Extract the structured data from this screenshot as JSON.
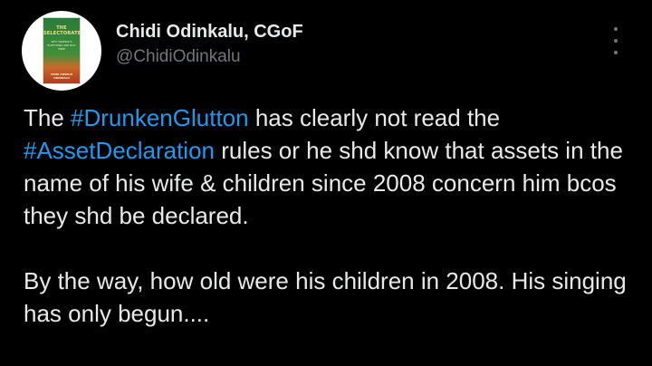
{
  "author": {
    "name": "Chidi Odinkalu, CGoF",
    "handle": "@ChidiOdinkalu",
    "avatar": {
      "book_title": "THE SELECTORATE",
      "book_subtitle": "WHY NIGERIA'S ELECTIONS ARE NOT FREE",
      "book_author": "CHIDI ANSELM ODINKALU"
    }
  },
  "menu": {
    "icon": "more-vertical-icon"
  },
  "tweet": {
    "p1_t1": "The ",
    "p1_h1": "#DrunkenGlutton",
    "p1_t2": " has clearly not read the",
    "p1_h2": "#AssetDeclaration",
    "p1_t3": " rules or he shd know that assets in the name of his wife & children since 2008 concern him bcos they shd be declared.",
    "p2": "By the way, how old were his children in 2008. His singing has only begun...."
  },
  "colors": {
    "background": "#000000",
    "text": "#e7e9ea",
    "secondary": "#71767b",
    "link": "#1d9bf0"
  }
}
